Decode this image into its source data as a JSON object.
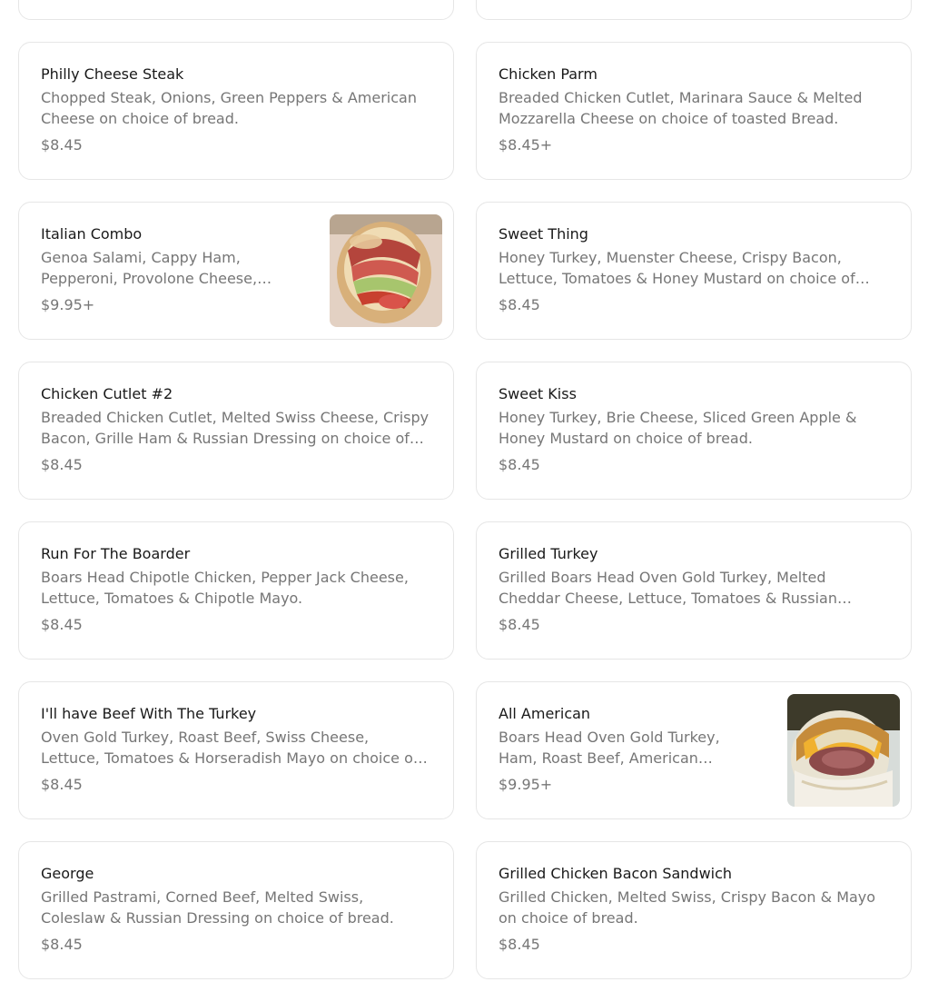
{
  "menu": {
    "items": [
      {
        "title": "",
        "desc": "",
        "price": ""
      },
      {
        "title": "",
        "desc": "",
        "price": ""
      },
      {
        "title": "Philly Cheese Steak",
        "desc": "Chopped Steak, Onions, Green Peppers & American Cheese on choice of bread.",
        "price": "$8.45"
      },
      {
        "title": "Chicken Parm",
        "desc": "Breaded Chicken Cutlet, Marinara Sauce & Melted Mozzarella Cheese on choice of toasted Bread.",
        "price": "$8.45+"
      },
      {
        "title": "Italian Combo",
        "desc": "Genoa Salami, Cappy Ham, Pepperoni, Provolone Cheese, Lettuce, Tomatoes, Onions, Oil & Vinegar on choice of bread.",
        "price": "$9.95+",
        "image": "italian-combo-sandwich-photo"
      },
      {
        "title": "Sweet Thing",
        "desc": "Honey Turkey, Muenster Cheese, Crispy Bacon, Lettuce, Tomatoes & Honey Mustard on choice of bread.",
        "price": "$8.45"
      },
      {
        "title": "Chicken Cutlet #2",
        "desc": "Breaded Chicken Cutlet, Melted Swiss Cheese, Crispy Bacon, Grille Ham & Russian Dressing on choice of bread.",
        "price": "$8.45"
      },
      {
        "title": "Sweet Kiss",
        "desc": "Honey Turkey, Brie Cheese, Sliced Green Apple & Honey Mustard on choice of bread.",
        "price": "$8.45"
      },
      {
        "title": "Run For The Boarder",
        "desc": "Boars Head Chipotle Chicken, Pepper Jack Cheese, Lettuce, Tomatoes & Chipotle Mayo.",
        "price": "$8.45"
      },
      {
        "title": "Grilled Turkey",
        "desc": "Grilled Boars Head Oven Gold Turkey, Melted Cheddar Cheese, Lettuce, Tomatoes & Russian Dressing on choice of bread.",
        "price": "$8.45"
      },
      {
        "title": "I'll have Beef With The Turkey",
        "desc": "Oven Gold Turkey, Roast Beef, Swiss Cheese, Lettuce, Tomatoes & Horseradish Mayo on choice of bread.",
        "price": "$8.45"
      },
      {
        "title": "All American",
        "desc": "Boars Head Oven Gold Turkey, Ham, Roast Beef, American Cheese, Lettuce, Tomatoes & Mayo on choice of bread.",
        "price": "$9.95+",
        "image": "all-american-sandwich-photo"
      },
      {
        "title": "George",
        "desc": "Grilled Pastrami, Corned Beef, Melted Swiss, Coleslaw & Russian Dressing on choice of bread.",
        "price": "$8.45"
      },
      {
        "title": "Grilled Chicken Bacon Sandwich",
        "desc": "Grilled Chicken, Melted Swiss, Crispy Bacon & Mayo on choice of bread.",
        "price": "$8.45"
      }
    ]
  },
  "colors": {
    "card_border": "#e6e6e6",
    "title_text": "#191919",
    "secondary_text": "#767676",
    "background": "#ffffff"
  }
}
